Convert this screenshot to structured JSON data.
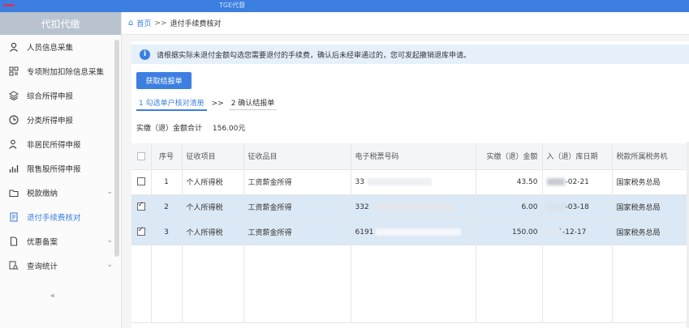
{
  "app": {
    "title": "TGE代督",
    "brand_color": "#3d7fe0"
  },
  "sidebar": {
    "header": "代扣代缴",
    "items": [
      {
        "label": "人员信息采集",
        "icon": "person-icon"
      },
      {
        "label": "专项附加扣除信息采集",
        "icon": "grid-icon"
      },
      {
        "label": "综合所得申报",
        "icon": "layers-icon"
      },
      {
        "label": "分类所得申报",
        "icon": "clock-icon"
      },
      {
        "label": "非居民所得申报",
        "icon": "user-icon"
      },
      {
        "label": "限售股所得申报",
        "icon": "bar-chart-icon"
      },
      {
        "label": "税款缴纳",
        "icon": "folder-icon"
      },
      {
        "label": "退付手续费核对",
        "icon": "document-icon"
      },
      {
        "label": "优惠备案",
        "icon": "file-icon"
      },
      {
        "label": "查询统计",
        "icon": "search-document-icon"
      }
    ],
    "collapse": "«"
  },
  "breadcrumb": {
    "home": "首页",
    "sep": ">>",
    "current": "退付手续费核对"
  },
  "notice": {
    "text": "请根据实际未退付金额勾选您需要退付的手续费，确认后未经审通过的，您可发起撤销退库申请。"
  },
  "buttons": {
    "get_report": "获取结报单"
  },
  "steps": {
    "step1": "1 勾选单户核对清册",
    "sep": ">>",
    "step2": "2 确认结报单"
  },
  "total": {
    "label": "实缴（退）金额合计",
    "value": "156.00元"
  },
  "table": {
    "headers": [
      "",
      "序号",
      "征收项目",
      "征收品目",
      "电子税票号码",
      "实缴（退）金额",
      "入（退）库日期",
      "税款所属税务机"
    ],
    "rows": [
      {
        "checked": false,
        "seq": "1",
        "item": "个人所得税",
        "subitem": "工资薪金所得",
        "ticket": "33",
        "amount": "43.50",
        "date": "-02-21",
        "org": "国家税务总局"
      },
      {
        "checked": true,
        "seq": "2",
        "item": "个人所得税",
        "subitem": "工资薪金所得",
        "ticket": "332",
        "amount": "6.00",
        "date": "-03-18",
        "org": "国家税务总局"
      },
      {
        "checked": true,
        "seq": "3",
        "item": "个人所得税",
        "subitem": "工资薪金所得",
        "ticket": "6191",
        "amount": "150.00",
        "date": "`-12-17",
        "org": "国家税务总局"
      }
    ]
  }
}
